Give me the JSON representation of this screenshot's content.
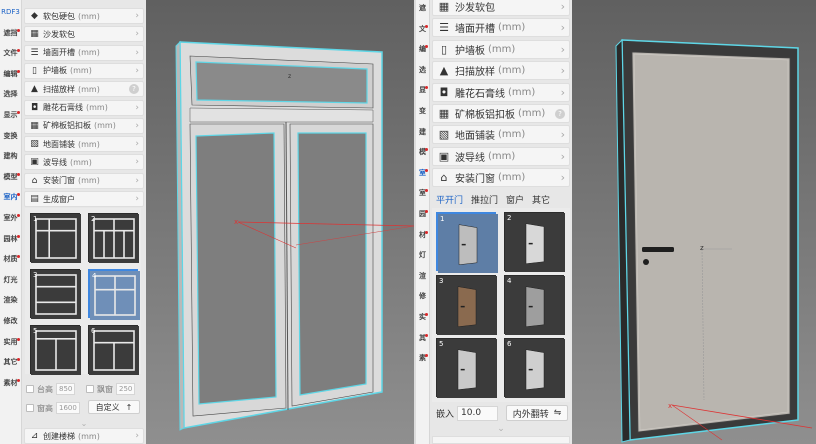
{
  "left": {
    "toolbar": [
      {
        "label": "RDF3",
        "kind": "brand"
      },
      {
        "label": "遮挡",
        "dot": true
      },
      {
        "label": "文件",
        "dot": true
      },
      {
        "label": "编辑",
        "dot": true
      },
      {
        "label": "选择",
        "dot": false
      },
      {
        "label": "显示",
        "dot": true
      },
      {
        "label": "变换",
        "dot": false
      },
      {
        "label": "建构",
        "dot": false
      },
      {
        "label": "模型",
        "dot": true
      },
      {
        "label": "室内",
        "dot": true,
        "active": true
      },
      {
        "label": "室外",
        "dot": true
      },
      {
        "label": "园林",
        "dot": true
      },
      {
        "label": "材质",
        "dot": true
      },
      {
        "label": "灯光",
        "dot": false
      },
      {
        "label": "渲染",
        "dot": false
      },
      {
        "label": "修改",
        "dot": false
      },
      {
        "label": "实用",
        "dot": true
      },
      {
        "label": "其它",
        "dot": true
      },
      {
        "label": "素材",
        "dot": true
      }
    ],
    "panel_items": [
      {
        "icon": "◆",
        "icon_name": "diamond-icon",
        "label": "软包硬包",
        "unit": "(mm)"
      },
      {
        "icon": "▦",
        "icon_name": "upholstery-icon",
        "label": "沙发软包",
        "unit": ""
      },
      {
        "icon": "☰",
        "icon_name": "wall-slot-icon",
        "label": "墙面开槽",
        "unit": "(mm)"
      },
      {
        "icon": "▯",
        "icon_name": "wall-panel-icon",
        "label": "护墙板",
        "unit": "(mm)"
      },
      {
        "icon": "▲",
        "icon_name": "sweep-icon",
        "label": "扫描放样",
        "unit": "(mm)",
        "help": true
      },
      {
        "icon": "◘",
        "icon_name": "molding-icon",
        "label": "雕花石膏线",
        "unit": "(mm)"
      },
      {
        "icon": "▦",
        "icon_name": "ceiling-grid-icon",
        "label": "矿棉板铝扣板",
        "unit": "(mm)"
      },
      {
        "icon": "▧",
        "icon_name": "floor-tile-icon",
        "label": "地面铺装",
        "unit": "(mm)"
      },
      {
        "icon": "▣",
        "icon_name": "skirting-icon",
        "label": "波导线",
        "unit": "(mm)"
      },
      {
        "icon": "⌂",
        "icon_name": "door-window-icon",
        "label": "安装门窗",
        "unit": "(mm)"
      },
      {
        "icon": "▤",
        "icon_name": "window-icon",
        "label": "生成窗户",
        "unit": ""
      }
    ],
    "thumbnails": [
      "1",
      "2",
      "3",
      "4",
      "5",
      "6"
    ],
    "selected_thumbnail": "4",
    "options": {
      "sill_label": "台高",
      "sill_value": "850",
      "window_label": "飘窗",
      "window_value": "250",
      "height_label": "窗高",
      "height_value": "1600",
      "custom_label": "自定义",
      "custom_arrow": "↑"
    },
    "bottom_item": {
      "icon": "⊿",
      "label": "创建楼梯",
      "unit": "(mm)"
    }
  },
  "right": {
    "toolbar": [
      {
        "label": "遮",
        "dot": false
      },
      {
        "label": "文",
        "dot": true
      },
      {
        "label": "编",
        "dot": true
      },
      {
        "label": "选",
        "dot": false
      },
      {
        "label": "显",
        "dot": true
      },
      {
        "label": "变",
        "dot": false
      },
      {
        "label": "建",
        "dot": false
      },
      {
        "label": "模",
        "dot": true
      },
      {
        "label": "室",
        "dot": true,
        "active": true
      },
      {
        "label": "室",
        "dot": true
      },
      {
        "label": "园",
        "dot": true
      },
      {
        "label": "材",
        "dot": true
      },
      {
        "label": "灯",
        "dot": false
      },
      {
        "label": "渲",
        "dot": false
      },
      {
        "label": "修",
        "dot": false
      },
      {
        "label": "实",
        "dot": true
      },
      {
        "label": "其",
        "dot": true
      },
      {
        "label": "素",
        "dot": true
      }
    ],
    "panel_items": [
      {
        "icon": "▦",
        "icon_name": "upholstery-icon",
        "label": "沙发软包",
        "unit": ""
      },
      {
        "icon": "☰",
        "icon_name": "wall-slot-icon",
        "label": "墙面开槽",
        "unit": "(mm)"
      },
      {
        "icon": "▯",
        "icon_name": "wall-panel-icon",
        "label": "护墙板",
        "unit": "(mm)"
      },
      {
        "icon": "▲",
        "icon_name": "sweep-icon",
        "label": "扫描放样",
        "unit": "(mm)"
      },
      {
        "icon": "◘",
        "icon_name": "molding-icon",
        "label": "雕花石膏线",
        "unit": "(mm)"
      },
      {
        "icon": "▦",
        "icon_name": "ceiling-grid-icon",
        "label": "矿棉板铝扣板",
        "unit": "(mm)",
        "help": true
      },
      {
        "icon": "▧",
        "icon_name": "floor-tile-icon",
        "label": "地面铺装",
        "unit": "(mm)"
      },
      {
        "icon": "▣",
        "icon_name": "skirting-icon",
        "label": "波导线",
        "unit": "(mm)"
      },
      {
        "icon": "⌂",
        "icon_name": "door-window-icon",
        "label": "安装门窗",
        "unit": "(mm)"
      }
    ],
    "tabs": [
      {
        "label": "平开门",
        "active": true
      },
      {
        "label": "推拉门",
        "active": false
      },
      {
        "label": "窗户",
        "active": false
      },
      {
        "label": "其它",
        "active": false
      }
    ],
    "thumbnails": [
      "1",
      "2",
      "3",
      "4",
      "5",
      "6"
    ],
    "selected_thumbnail": "1",
    "embed_label": "嵌入",
    "embed_value": "10.0",
    "flip_label": "内外翻转",
    "flip_icon": "⇋"
  },
  "viewport_left": {
    "axis_label": "z",
    "axis_label_x": "x"
  },
  "viewport_right": {
    "axis_label": "z",
    "axis_label_x": "x"
  }
}
